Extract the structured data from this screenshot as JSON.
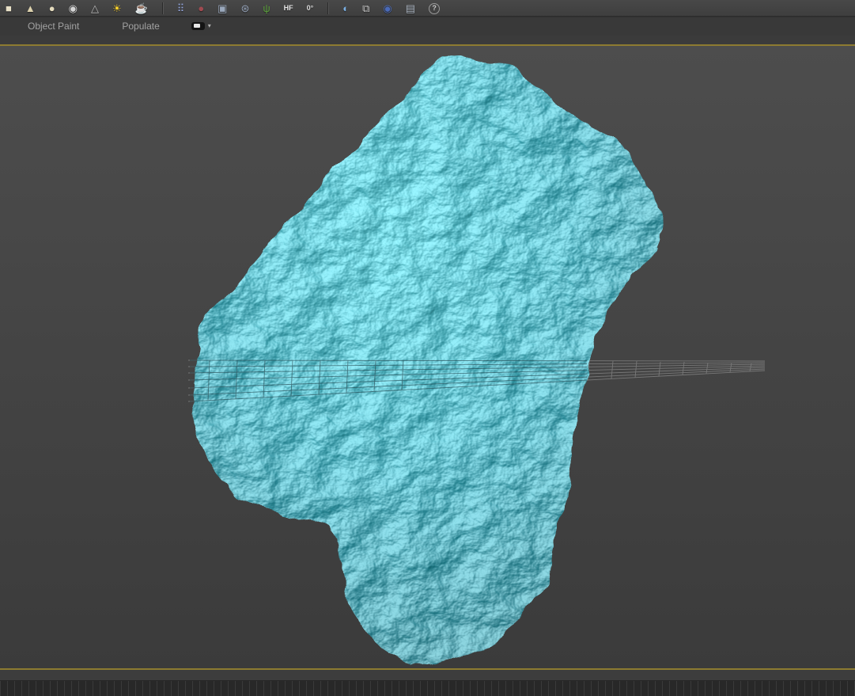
{
  "toolbar": {
    "icons": [
      {
        "name": "standard-box-icon",
        "glyph": "■",
        "color": "#e9e1c8"
      },
      {
        "name": "cone-icon",
        "glyph": "▲",
        "color": "#ddd2ad"
      },
      {
        "name": "sphere-icon",
        "glyph": "●",
        "color": "#e4dbbd"
      },
      {
        "name": "geosphere-icon",
        "glyph": "◉",
        "color": "#d6d6d6"
      },
      {
        "name": "pyramid-icon",
        "glyph": "△",
        "color": "#bcbcbc"
      },
      {
        "name": "sunlight-icon",
        "glyph": "☀",
        "color": "#ffd42a"
      },
      {
        "name": "teapot-icon",
        "glyph": "☕",
        "color": "#dfd6b4"
      },
      {
        "type": "sep"
      },
      {
        "name": "array-scatter-icon",
        "glyph": "⠿",
        "color": "#8fa0d4"
      },
      {
        "name": "paint-sphere-icon",
        "glyph": "●",
        "color": "#a04a50"
      },
      {
        "name": "image-plane-icon",
        "glyph": "▣",
        "color": "#9aa8bc"
      },
      {
        "name": "gear-flower-icon",
        "glyph": "⊛",
        "color": "#93a0b4"
      },
      {
        "name": "foliage-icon",
        "glyph": "ψ",
        "color": "#5a9c3c"
      },
      {
        "name": "height-field-icon",
        "glyph": "HF",
        "color": "#e6e6e6",
        "type": "text"
      },
      {
        "name": "angle-icon",
        "glyph": "0°",
        "color": "#d8d8d8",
        "type": "text"
      },
      {
        "type": "sep"
      },
      {
        "name": "shaded-sphere-icon",
        "glyph": "◐",
        "color": "#7ab0e4"
      },
      {
        "name": "viewport-layout-icon",
        "glyph": "⧉",
        "color": "#c6c6c6"
      },
      {
        "name": "scene-orb-icon",
        "glyph": "◉",
        "color": "#4a6ab8"
      },
      {
        "name": "display-monitor-icon",
        "glyph": "▤",
        "color": "#aab4c0"
      },
      {
        "name": "help-icon",
        "glyph": "?",
        "color": "#c8c8c8",
        "type": "help"
      }
    ]
  },
  "ribbon": {
    "tabs": [
      {
        "label": "Object Paint"
      },
      {
        "label": "Populate"
      }
    ],
    "toggle_caret": "▾"
  },
  "viewport": {
    "object": "teal-rock-mesh",
    "object_color": "#2ba4b4",
    "grid_color": "#8a8a8a",
    "background_top": "#4d4d4d",
    "background_bottom": "#3b3b3b"
  },
  "colors": {
    "viewport_border_accent": "#8d7b31",
    "ui_background": "#3c3c3c",
    "timeline_background": "#282828"
  }
}
